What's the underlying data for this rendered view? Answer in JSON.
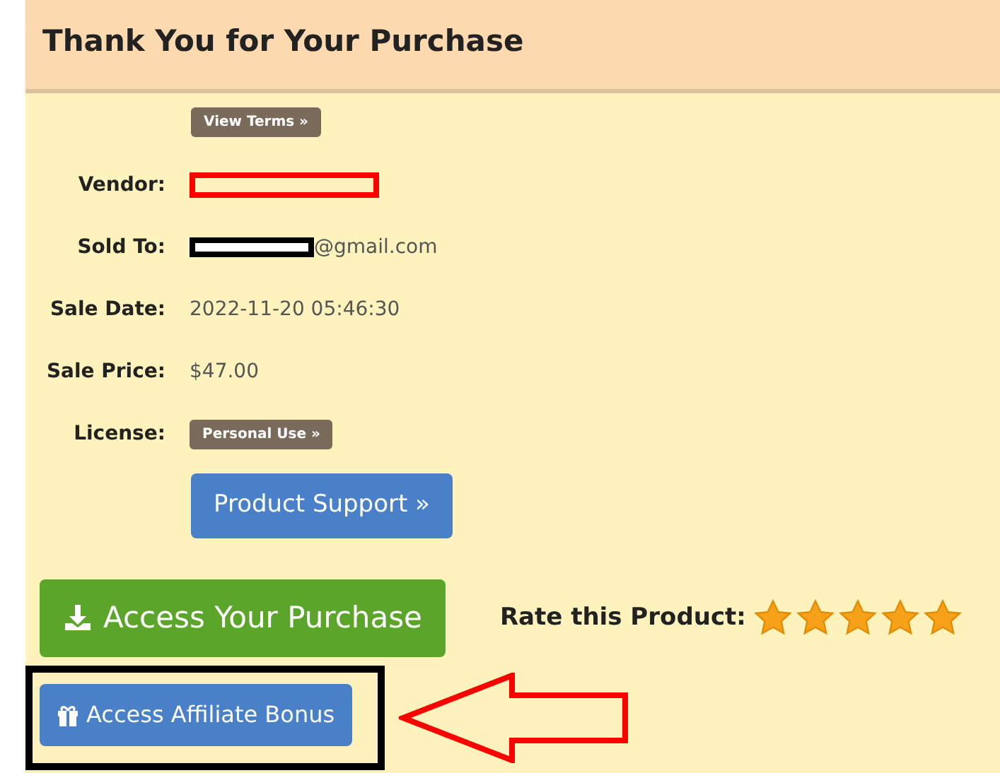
{
  "header": {
    "title": "Thank You for Your Purchase"
  },
  "view_terms": "View Terms »",
  "fields": [
    {
      "label": "Vendor:",
      "kind": "redacted-outline"
    },
    {
      "label": "Sold To:",
      "kind": "redacted-email",
      "value": "@gmail.com"
    },
    {
      "label": "Sale Date:",
      "kind": "text",
      "value": "2022-11-20 05:46:30"
    },
    {
      "label": "Sale Price:",
      "kind": "text",
      "value": "$47.00"
    },
    {
      "label": "License:",
      "kind": "badge",
      "value": "Personal Use »"
    }
  ],
  "support_button": "Product Support »",
  "access_button": "Access Your Purchase",
  "rating": {
    "label": "Rate this Product:",
    "stars": 5
  },
  "affiliate_button": {
    "label": "Access Affiliate Bonus",
    "highlighted": true
  }
}
